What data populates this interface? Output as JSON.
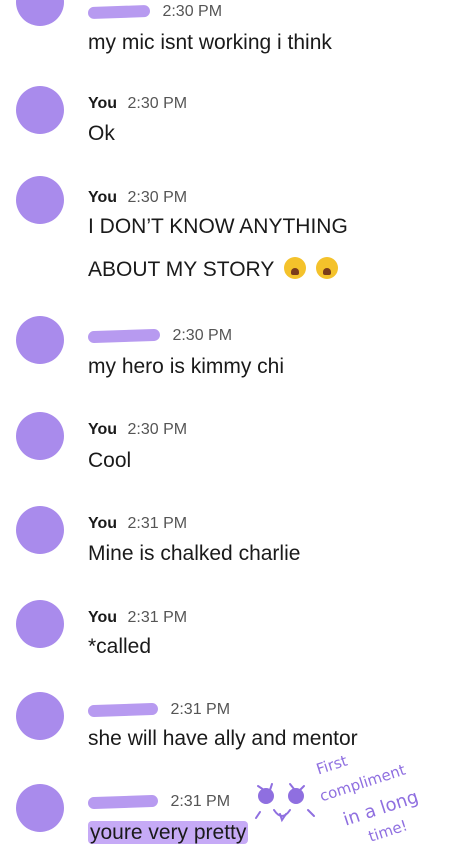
{
  "messages": [
    {
      "sender": "",
      "sender_redacted": true,
      "time": "2:30 PM",
      "text": "my mic isnt working i think"
    },
    {
      "sender": "You",
      "sender_redacted": false,
      "time": "2:30 PM",
      "text": "Ok"
    },
    {
      "sender": "You",
      "sender_redacted": false,
      "time": "2:30 PM",
      "text_line1": "I DON’T KNOW ANYTHING",
      "text_line2": "ABOUT MY STORY",
      "emojis": [
        "loudly-crying-face",
        "loudly-crying-face"
      ]
    },
    {
      "sender": "",
      "sender_redacted": true,
      "time": "2:30 PM",
      "text": "my hero is kimmy chi"
    },
    {
      "sender": "You",
      "sender_redacted": false,
      "time": "2:30 PM",
      "text": "Cool"
    },
    {
      "sender": "You",
      "sender_redacted": false,
      "time": "2:31 PM",
      "text": "Mine is chalked charlie"
    },
    {
      "sender": "You",
      "sender_redacted": false,
      "time": "2:31 PM",
      "text": "*called"
    },
    {
      "sender": "",
      "sender_redacted": true,
      "time": "2:31 PM",
      "text": "she will have ally and mentor"
    },
    {
      "sender": "",
      "sender_redacted": true,
      "time": "2:31 PM",
      "text": "youre very pretty",
      "highlighted": true
    }
  ],
  "annotation": {
    "line1": "First",
    "line2": "compliment",
    "line3": "in a long",
    "line4": "time!"
  },
  "colors": {
    "avatar": "#a98bec",
    "redaction": "#b79af0",
    "highlight": "#c6aaf6",
    "doodle": "#8f6fe0"
  }
}
